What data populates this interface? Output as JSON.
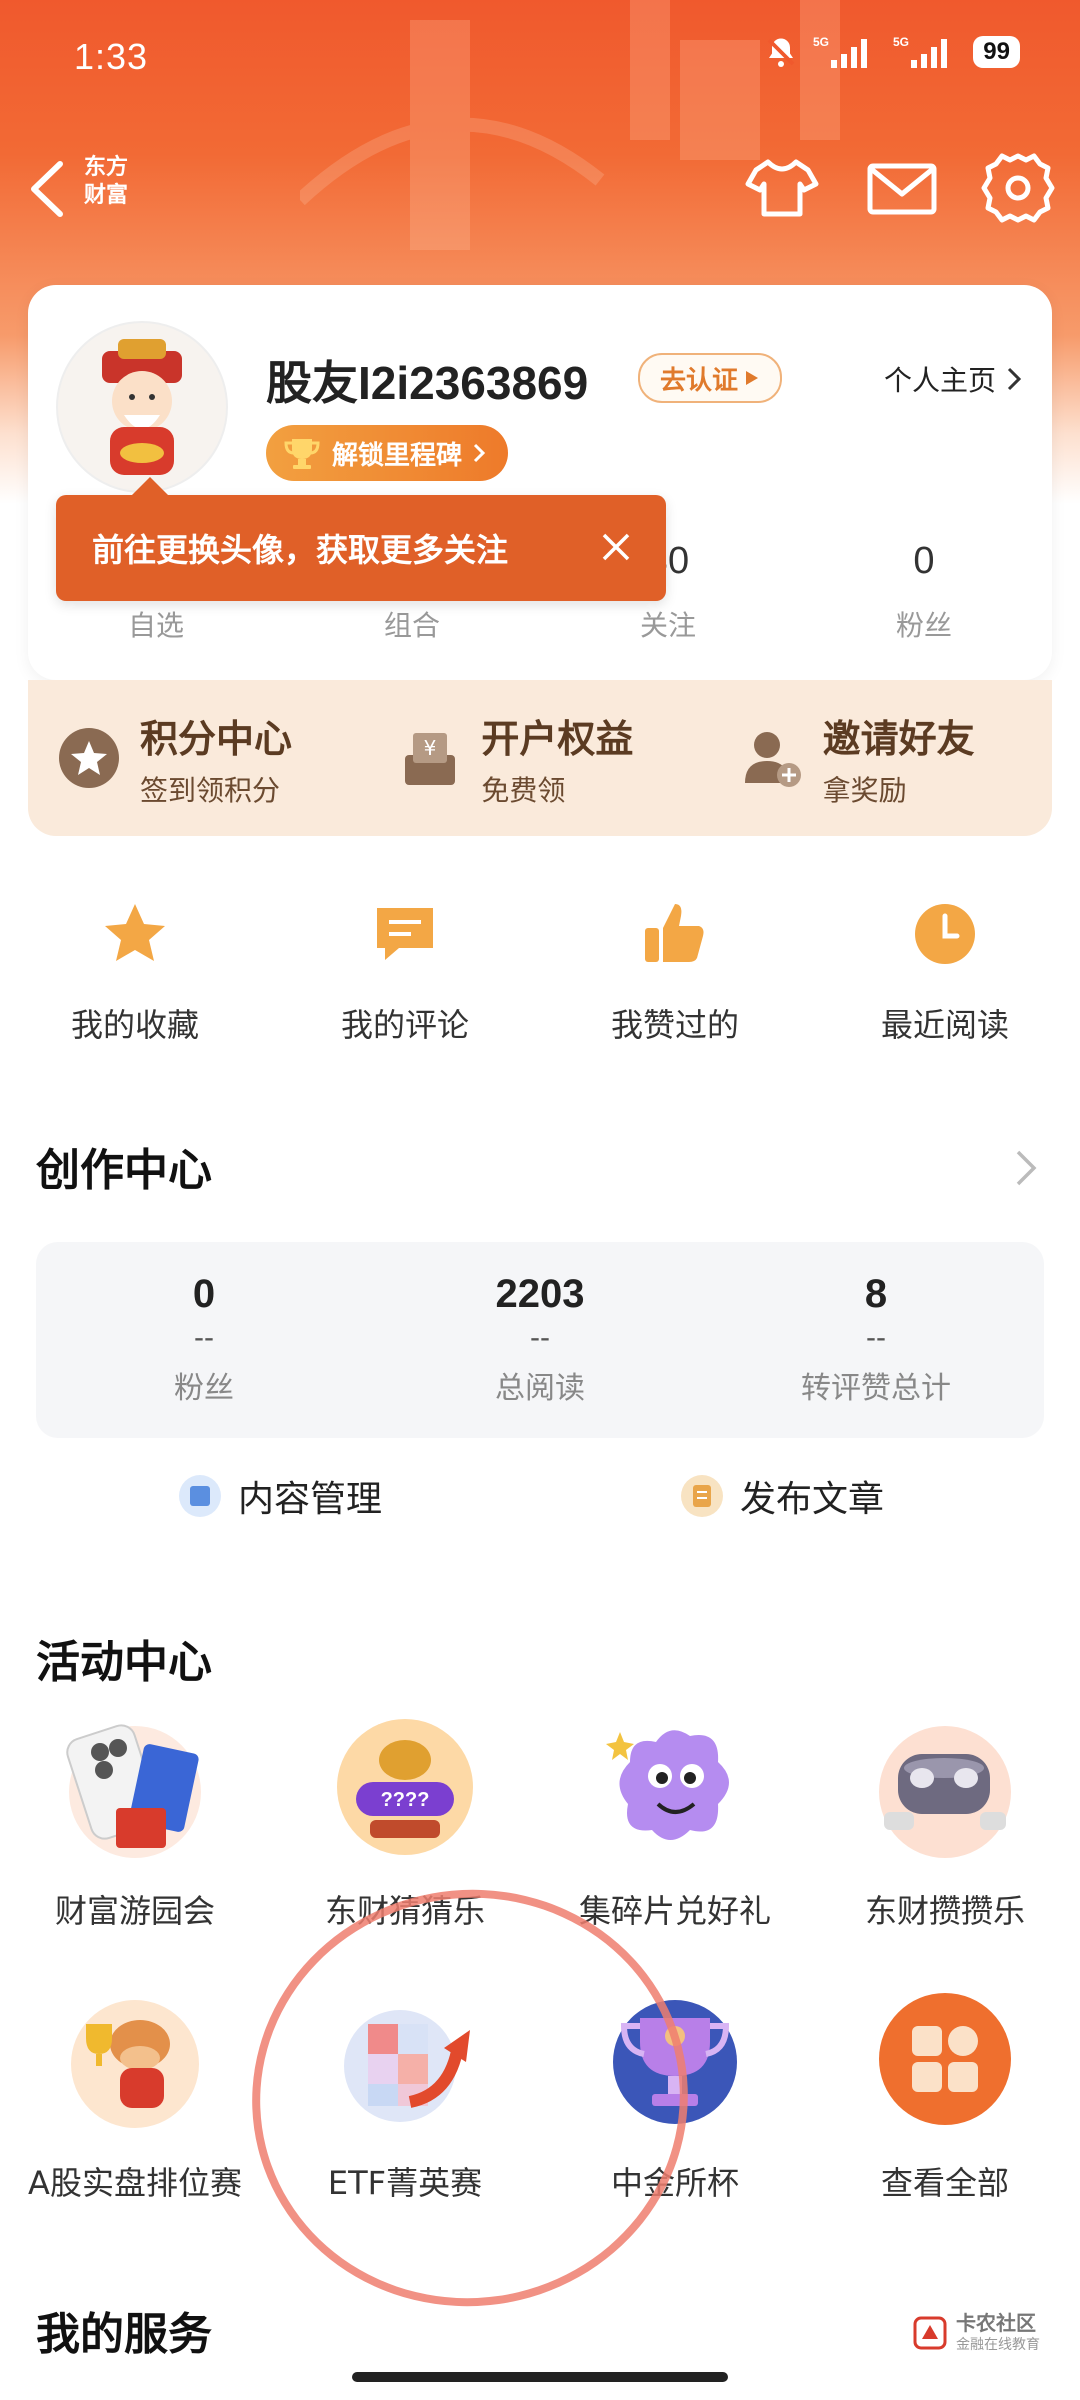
{
  "status_bar": {
    "time": "1:33",
    "battery": "99",
    "signal1": "5G",
    "signal2": "5G"
  },
  "nav": {
    "brand_line1": "东方",
    "brand_line2": "财富"
  },
  "profile": {
    "username": "股友I2i2363869",
    "verify_label": "去认证",
    "homepage_label": "个人主页",
    "milestone_label": "解锁里程碑",
    "stats": [
      {
        "value": "",
        "label": "自选"
      },
      {
        "value": "",
        "label": "组合"
      },
      {
        "value": "30",
        "label": "关注"
      },
      {
        "value": "0",
        "label": "粉丝"
      }
    ]
  },
  "tooltip": {
    "text": "前往更换头像，获取更多关注"
  },
  "benefits": [
    {
      "title": "积分中心",
      "sub": "签到领积分",
      "icon": "star-coin-icon"
    },
    {
      "title": "开户权益",
      "sub": "免费领",
      "icon": "yen-box-icon"
    },
    {
      "title": "邀请好友",
      "sub": "拿奖励",
      "icon": "add-user-icon"
    }
  ],
  "quick_actions": [
    {
      "label": "我的收藏",
      "icon": "star-icon"
    },
    {
      "label": "我的评论",
      "icon": "comment-icon"
    },
    {
      "label": "我赞过的",
      "icon": "thumbs-up-icon"
    },
    {
      "label": "最近阅读",
      "icon": "clock-icon"
    }
  ],
  "creator": {
    "title": "创作中心",
    "stats": [
      {
        "value": "0",
        "sub": "--",
        "label": "粉丝"
      },
      {
        "value": "2203",
        "sub": "--",
        "label": "总阅读"
      },
      {
        "value": "8",
        "sub": "--",
        "label": "转评赞总计"
      }
    ],
    "manage_label": "内容管理",
    "publish_label": "发布文章"
  },
  "activity": {
    "title": "活动中心",
    "items": [
      {
        "label": "财富游园会"
      },
      {
        "label": "东财猜猜乐"
      },
      {
        "label": "集碎片兑好礼"
      },
      {
        "label": "东财攒攒乐"
      },
      {
        "label": "A股实盘排位赛"
      },
      {
        "label": "ETF菁英赛"
      },
      {
        "label": "中金所杯"
      },
      {
        "label": "查看全部"
      }
    ]
  },
  "services": {
    "title": "我的服务"
  },
  "watermark": {
    "line1": "卡农社区",
    "line2": "金融在线教育"
  },
  "colors": {
    "brand": "#f0592d",
    "accent": "#ee7a2a",
    "gold": "#f0b04a"
  }
}
